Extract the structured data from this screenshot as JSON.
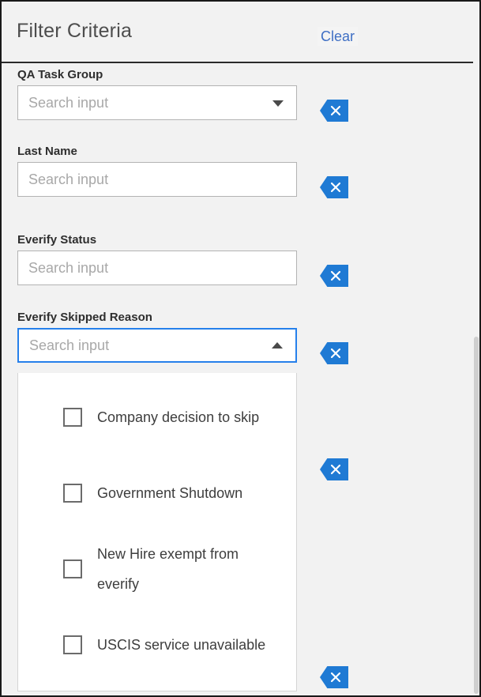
{
  "header": {
    "title": "Filter Criteria",
    "clear_label": "Clear"
  },
  "colors": {
    "accent_blue": "#1f7ad4",
    "link_blue": "#3f6fc4",
    "focus_border": "#2680eb",
    "panel_bg": "#f2f2f2",
    "label_text": "#2e2e2e",
    "placeholder_text": "#a8a8a8"
  },
  "fields": [
    {
      "label": "QA Task Group",
      "placeholder": "Search input",
      "value": "",
      "has_caret": true,
      "caret_direction": "down",
      "focused": false,
      "clear_icon": "close-icon"
    },
    {
      "label": "Last Name",
      "placeholder": "Search input",
      "value": "",
      "has_caret": false,
      "caret_direction": "",
      "focused": false,
      "clear_icon": "close-icon"
    },
    {
      "label": "Everify Status",
      "placeholder": "Search input",
      "value": "",
      "has_caret": false,
      "caret_direction": "",
      "focused": false,
      "clear_icon": "close-icon"
    },
    {
      "label": "Everify Skipped Reason",
      "placeholder": "Search input",
      "value": "",
      "has_caret": true,
      "caret_direction": "up",
      "focused": true,
      "clear_icon": "close-icon"
    }
  ],
  "dropdown": {
    "open": true,
    "belongs_to": "Everify Skipped Reason",
    "options": [
      {
        "label": "Company decision to skip",
        "checked": false
      },
      {
        "label": "Government Shutdown",
        "checked": false
      },
      {
        "label": "New Hire exempt from everify",
        "checked": false
      },
      {
        "label": "USCIS service unavailable",
        "checked": false
      }
    ]
  },
  "scrollbar": {
    "visible": true,
    "orientation": "vertical"
  }
}
